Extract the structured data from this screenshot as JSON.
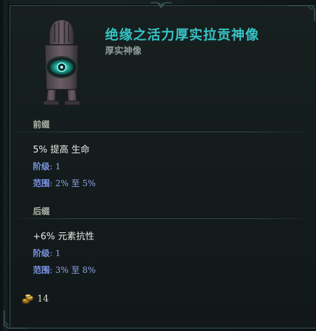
{
  "item": {
    "name": "绝缘之活力厚实拉贡神像",
    "base_type": "厚实神像",
    "image_icon": "idol-statue-with-eye-icon"
  },
  "prefix": {
    "header": "前缀",
    "affix_text": "5% 提高 生命",
    "tier_label": "阶级",
    "tier_value": ": 1",
    "range_label": "范围",
    "range_value": ": 2% 至 5%"
  },
  "suffix": {
    "header": "后缀",
    "affix_text": "+6% 元素抗性",
    "tier_label": "阶级",
    "tier_value": ": 1",
    "range_label": "范围",
    "range_value": ": 3% 至 8%"
  },
  "currency": {
    "icon": "gold-coins-icon",
    "count": "14"
  },
  "colors": {
    "title": "#36c2c5",
    "subtitle": "#8d9a96",
    "stat_label": "#7a95e6",
    "section_header": "#b3b8ad"
  }
}
